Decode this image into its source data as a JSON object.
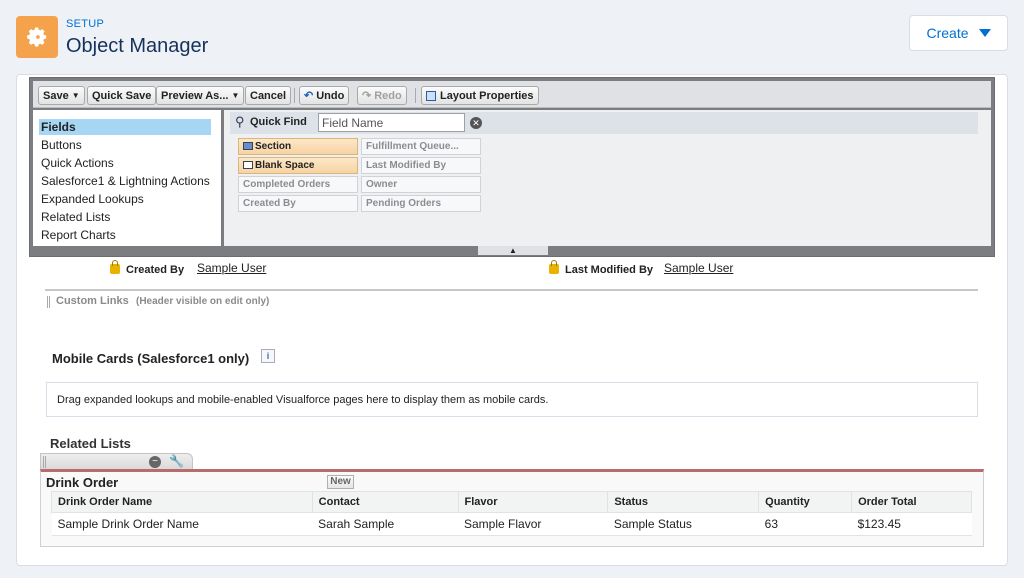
{
  "header": {
    "setup_label": "SETUP",
    "title": "Object Manager",
    "icon": "gear-icon",
    "create_label": "Create",
    "accent_color": "#0070d2",
    "icon_color": "#f4a24b"
  },
  "toolbar": {
    "save": "Save",
    "quick_save": "Quick Save",
    "preview_as": "Preview As...",
    "cancel": "Cancel",
    "undo": "Undo",
    "redo": "Redo",
    "layout_properties": "Layout Properties"
  },
  "palette": {
    "categories": [
      "Fields",
      "Buttons",
      "Quick Actions",
      "Salesforce1 & Lightning Actions",
      "Expanded Lookups",
      "Related Lists",
      "Report Charts"
    ],
    "selected_category": "Fields",
    "quick_find_label": "Quick Find",
    "quick_find_placeholder": "Field Name",
    "fields": [
      "Section",
      "Blank Space",
      "Completed Orders",
      "Created By",
      "Fulfillment Queue...",
      "Last Modified By",
      "Owner",
      "Pending Orders"
    ]
  },
  "layout": {
    "created_by_label": "Created By",
    "created_by_value": "Sample User",
    "last_modified_label": "Last Modified By",
    "last_modified_value": "Sample User",
    "custom_links_title": "Custom Links",
    "custom_links_note": "(Header visible on edit only)",
    "mobile_cards_title": "Mobile Cards (Salesforce1 only)",
    "mobile_cards_hint": "Drag expanded lookups and mobile-enabled Visualforce pages here to display them as mobile cards.",
    "related_lists_title": "Related Lists",
    "related_list": {
      "name": "Drink Order",
      "new_label": "New",
      "columns": [
        "Drink Order Name",
        "Contact",
        "Flavor",
        "Status",
        "Quantity",
        "Order Total"
      ],
      "rows": [
        [
          "Sample Drink Order Name",
          "Sarah Sample",
          "Sample Flavor",
          "Sample Status",
          "63",
          "$123.45"
        ]
      ]
    }
  }
}
